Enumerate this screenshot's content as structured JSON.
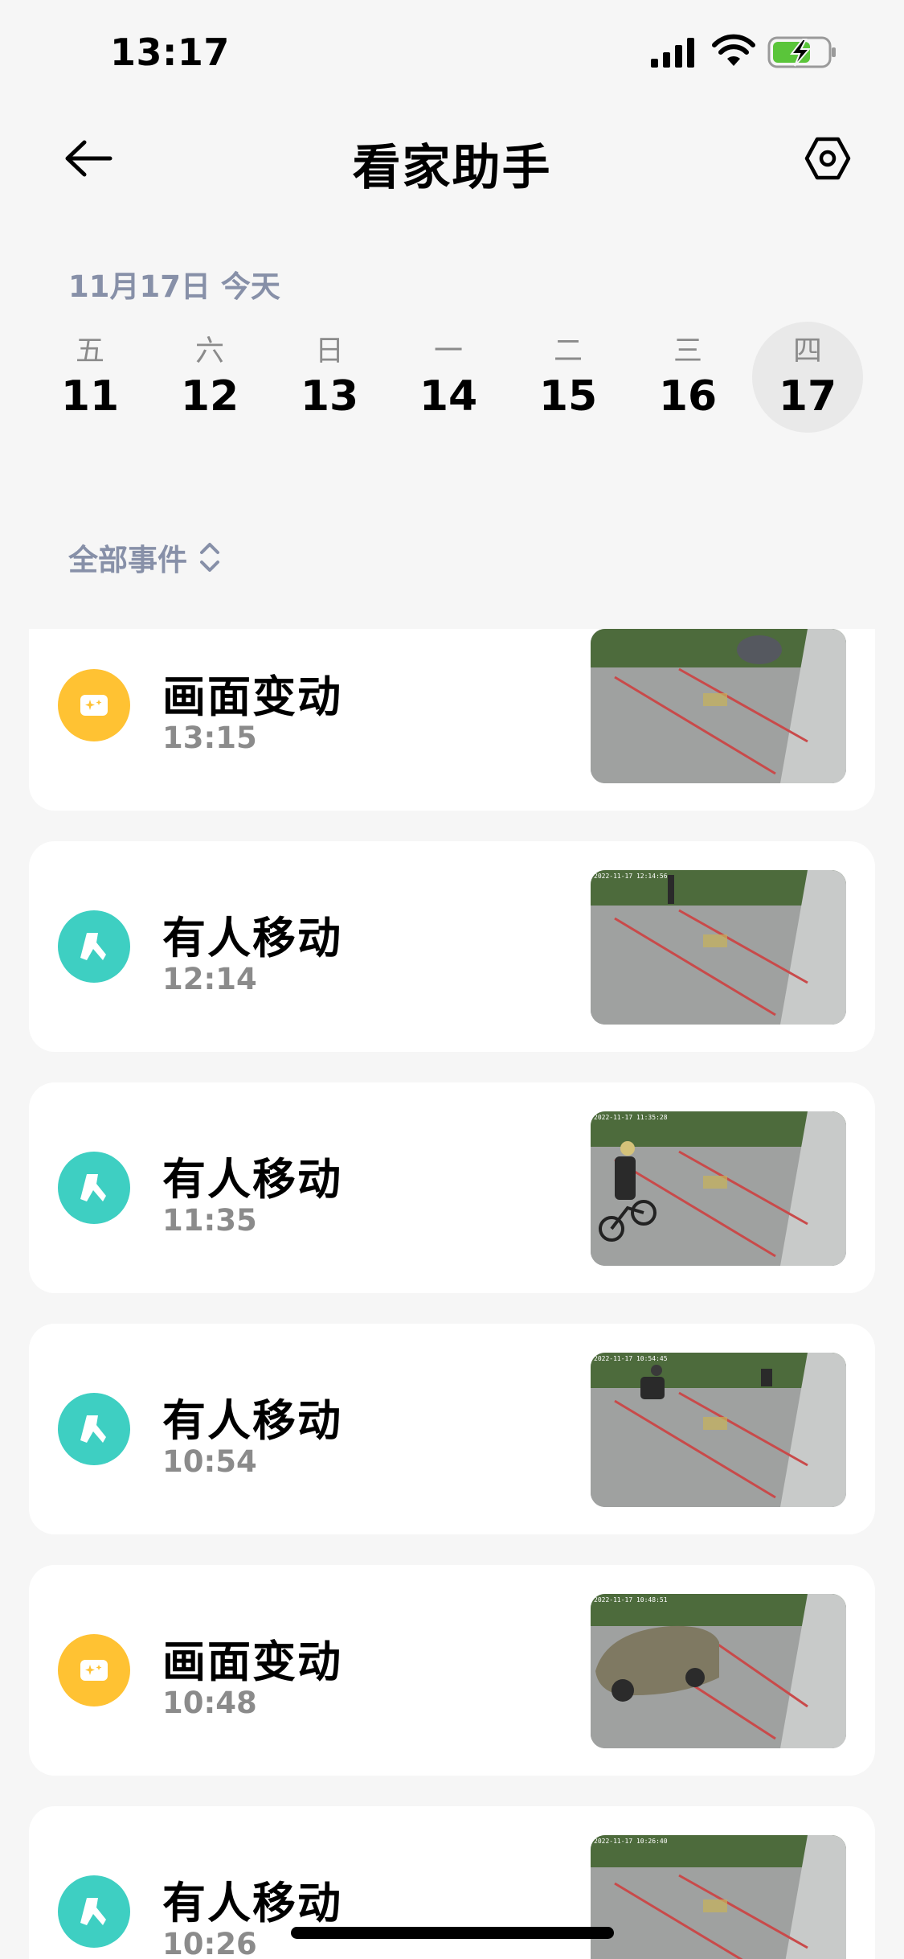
{
  "status_bar": {
    "time": "13:17",
    "icons": [
      "signal-icon",
      "wifi-icon",
      "battery-charging-icon"
    ]
  },
  "header": {
    "title": "看家助手",
    "back_icon": "arrow-left-icon",
    "settings_icon": "hexagon-settings-icon"
  },
  "date_label": "11月17日 今天",
  "week": [
    {
      "weekday": "五",
      "day": "11"
    },
    {
      "weekday": "六",
      "day": "12"
    },
    {
      "weekday": "日",
      "day": "13"
    },
    {
      "weekday": "一",
      "day": "14"
    },
    {
      "weekday": "二",
      "day": "15"
    },
    {
      "weekday": "三",
      "day": "16"
    },
    {
      "weekday": "四",
      "day": "17",
      "selected": true
    }
  ],
  "filter": {
    "label": "全部事件",
    "icon": "up-down-chevron-icon"
  },
  "events": [
    {
      "type": "motion",
      "title": "画面变动",
      "time": "13:15",
      "icon": "image-sparkle-icon",
      "thumb_stamp": ""
    },
    {
      "type": "person",
      "title": "有人移动",
      "time": "12:14",
      "icon": "walking-person-icon",
      "thumb_stamp": "2022-11-17 12:14:56"
    },
    {
      "type": "person",
      "title": "有人移动",
      "time": "11:35",
      "icon": "walking-person-icon",
      "thumb_stamp": "2022-11-17 11:35:28"
    },
    {
      "type": "person",
      "title": "有人移动",
      "time": "10:54",
      "icon": "walking-person-icon",
      "thumb_stamp": "2022-11-17 10:54:45"
    },
    {
      "type": "motion",
      "title": "画面变动",
      "time": "10:48",
      "icon": "image-sparkle-icon",
      "thumb_stamp": "2022-11-17 10:48:51"
    },
    {
      "type": "person",
      "title": "有人移动",
      "time": "10:26",
      "icon": "walking-person-icon",
      "thumb_stamp": "2022-11-17 10:26:40"
    }
  ],
  "colors": {
    "motion": "#ffc233",
    "person": "#3ecfc2",
    "muted": "#8790a8"
  }
}
